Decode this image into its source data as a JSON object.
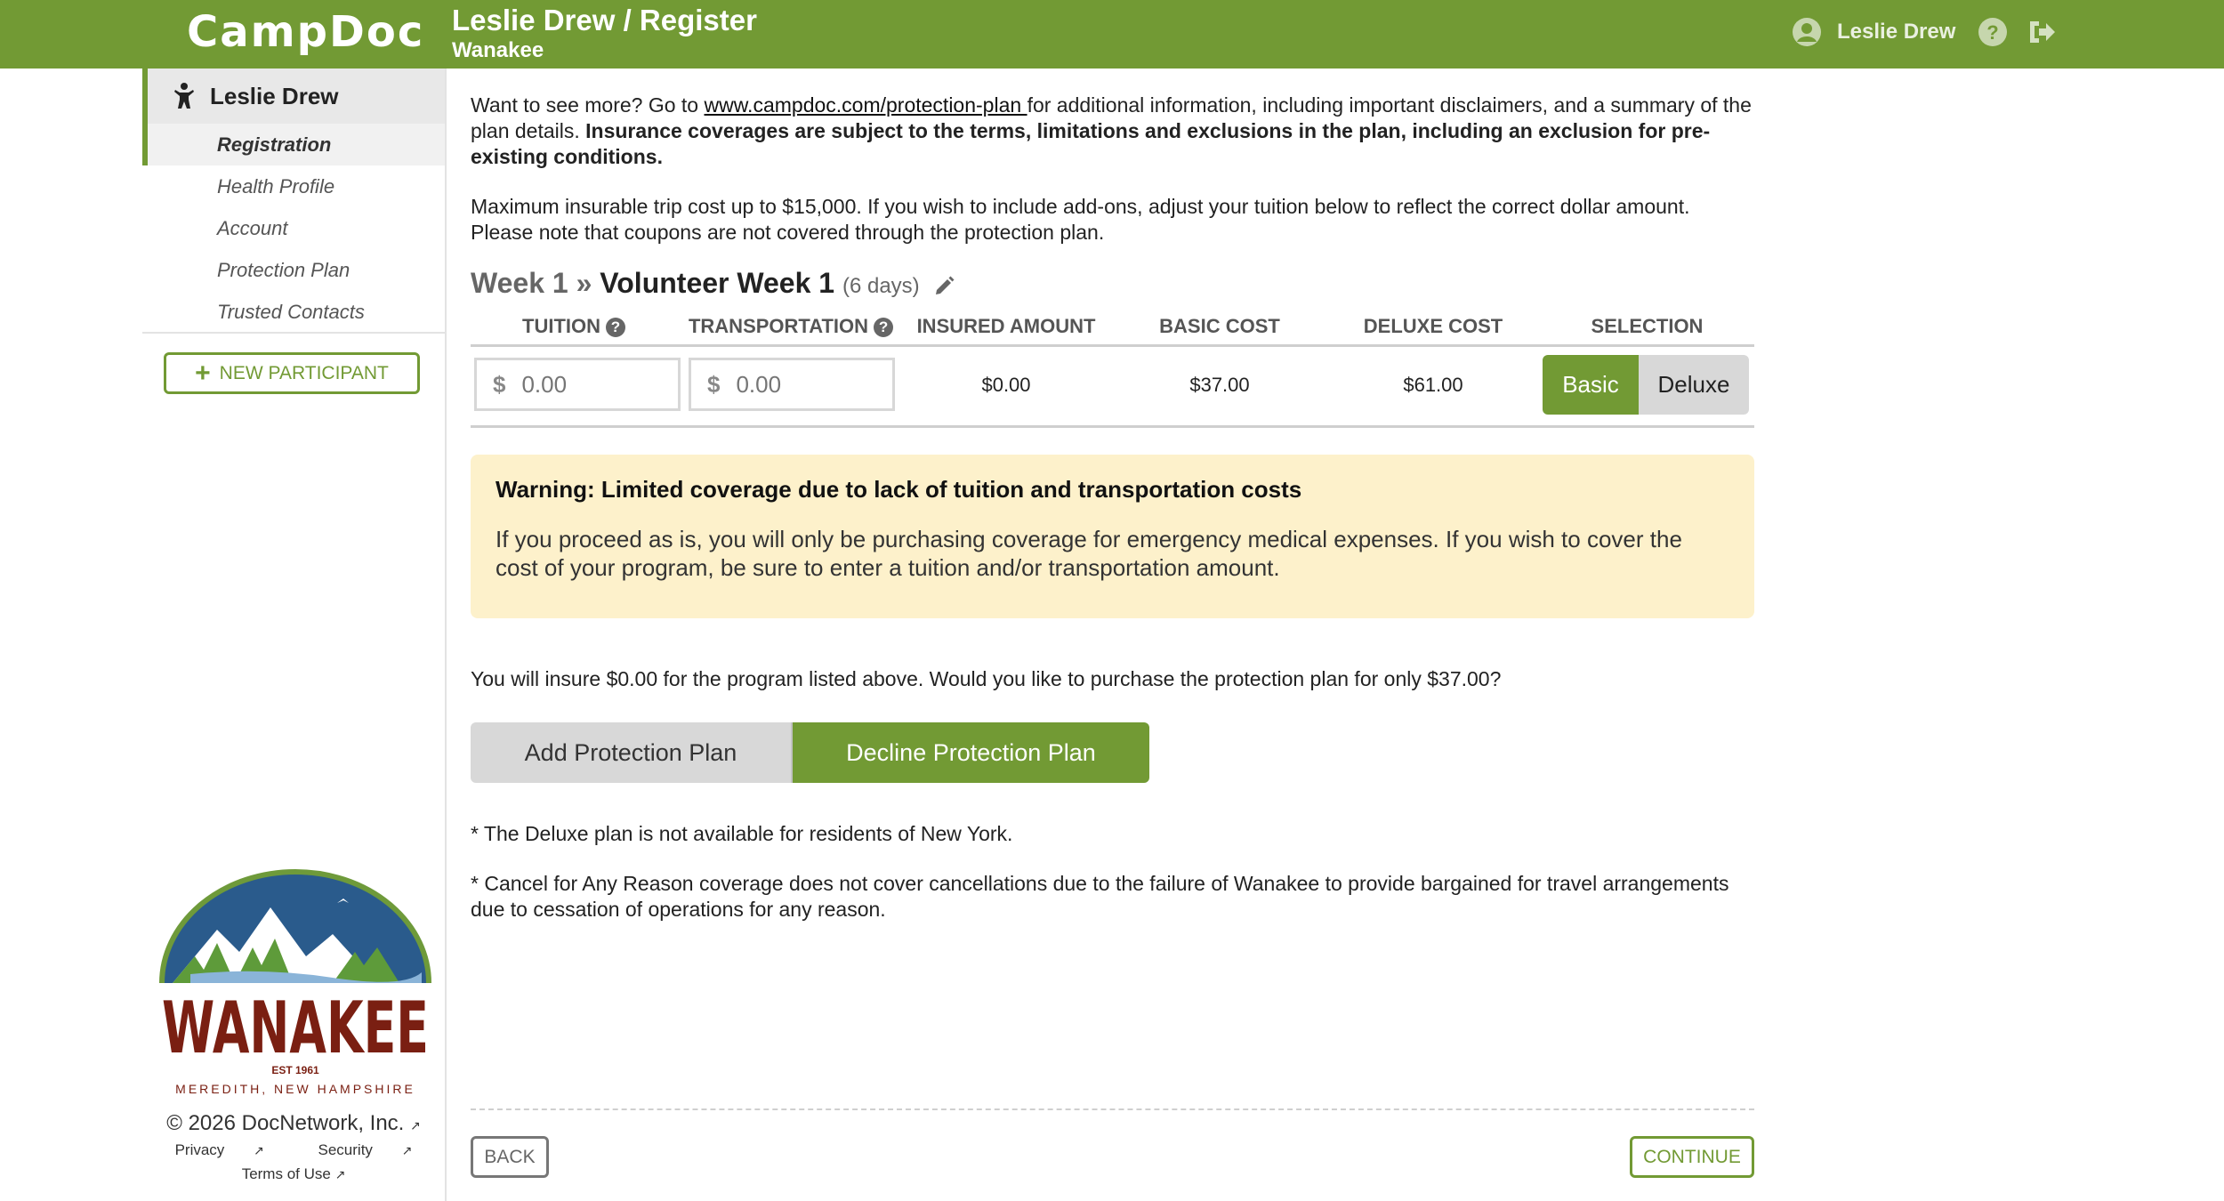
{
  "header": {
    "brand": "CampDoc",
    "title": "Leslie Drew / Register",
    "subtitle": "Wanakee",
    "user_name": "Leslie Drew"
  },
  "sidebar": {
    "participant_name": "Leslie Drew",
    "items": [
      {
        "label": "Registration",
        "active": true
      },
      {
        "label": "Health Profile",
        "active": false
      },
      {
        "label": "Account",
        "active": false
      },
      {
        "label": "Protection Plan",
        "active": false
      },
      {
        "label": "Trusted Contacts",
        "active": false
      }
    ],
    "new_participant_label": "NEW PARTICIPANT",
    "camp_logo": {
      "name": "WANAKEE",
      "est": "EST 1961",
      "location": "MEREDITH, NEW HAMPSHIRE"
    },
    "copyright": "© 2026 DocNetwork, Inc.",
    "links": {
      "privacy": "Privacy",
      "security": "Security",
      "terms": "Terms of Use"
    }
  },
  "main": {
    "intro": {
      "before_link": "Want to see more? Go to ",
      "link": "www.campdoc.com/protection-plan ",
      "after_link": "for additional information, including important disclaimers, and a summary of the plan details. ",
      "bold": "Insurance coverages are subject to the terms, limitations and exclusions in the plan, including an exclusion for pre-existing conditions."
    },
    "max_cost_note": "Maximum insurable trip cost up to $15,000. If you wish to include add-ons, adjust your tuition below to reflect the correct dollar amount. Please note that coupons are not covered through the protection plan.",
    "week": {
      "prefix": "Week 1",
      "separator": "»",
      "name": "Volunteer Week 1",
      "days": "(6 days)"
    },
    "table": {
      "headers": {
        "tuition": "TUITION",
        "transportation": "TRANSPORTATION",
        "insured_amount": "INSURED AMOUNT",
        "basic_cost": "BASIC COST",
        "deluxe_cost": "DELUXE COST",
        "selection": "SELECTION"
      },
      "row": {
        "currency_symbol": "$",
        "tuition_placeholder": "0.00",
        "transportation_placeholder": "0.00",
        "insured_amount": "$0.00",
        "basic_cost": "$37.00",
        "deluxe_cost": "$61.00",
        "selection_options": [
          "Basic",
          "Deluxe"
        ],
        "selected": "Basic"
      }
    },
    "warning": {
      "title": "Warning: Limited coverage due to lack of tuition and transportation costs",
      "body": "If you proceed as is, you will only be purchasing coverage for emergency medical expenses. If you wish to cover the cost of your program, be sure to enter a tuition and/or transportation amount."
    },
    "insure_question": "You will insure $0.00 for the program listed above. Would you like to purchase the protection plan for only $37.00?",
    "add_plan_label": "Add Protection Plan",
    "decline_plan_label": "Decline Protection Plan",
    "deluxe_note": "* The Deluxe plan is not available for residents of New York.",
    "cancel_note": "* Cancel for Any Reason coverage does not cover cancellations due to the failure of Wanakee to provide bargained for travel arrangements due to cessation of operations for any reason.",
    "back_label": "BACK",
    "continue_label": "CONTINUE"
  },
  "colors": {
    "brand_green": "#729a34",
    "warning_bg": "#fdf1cb",
    "logo_blue": "#2a5b8c",
    "logo_red": "#7a1f12"
  }
}
